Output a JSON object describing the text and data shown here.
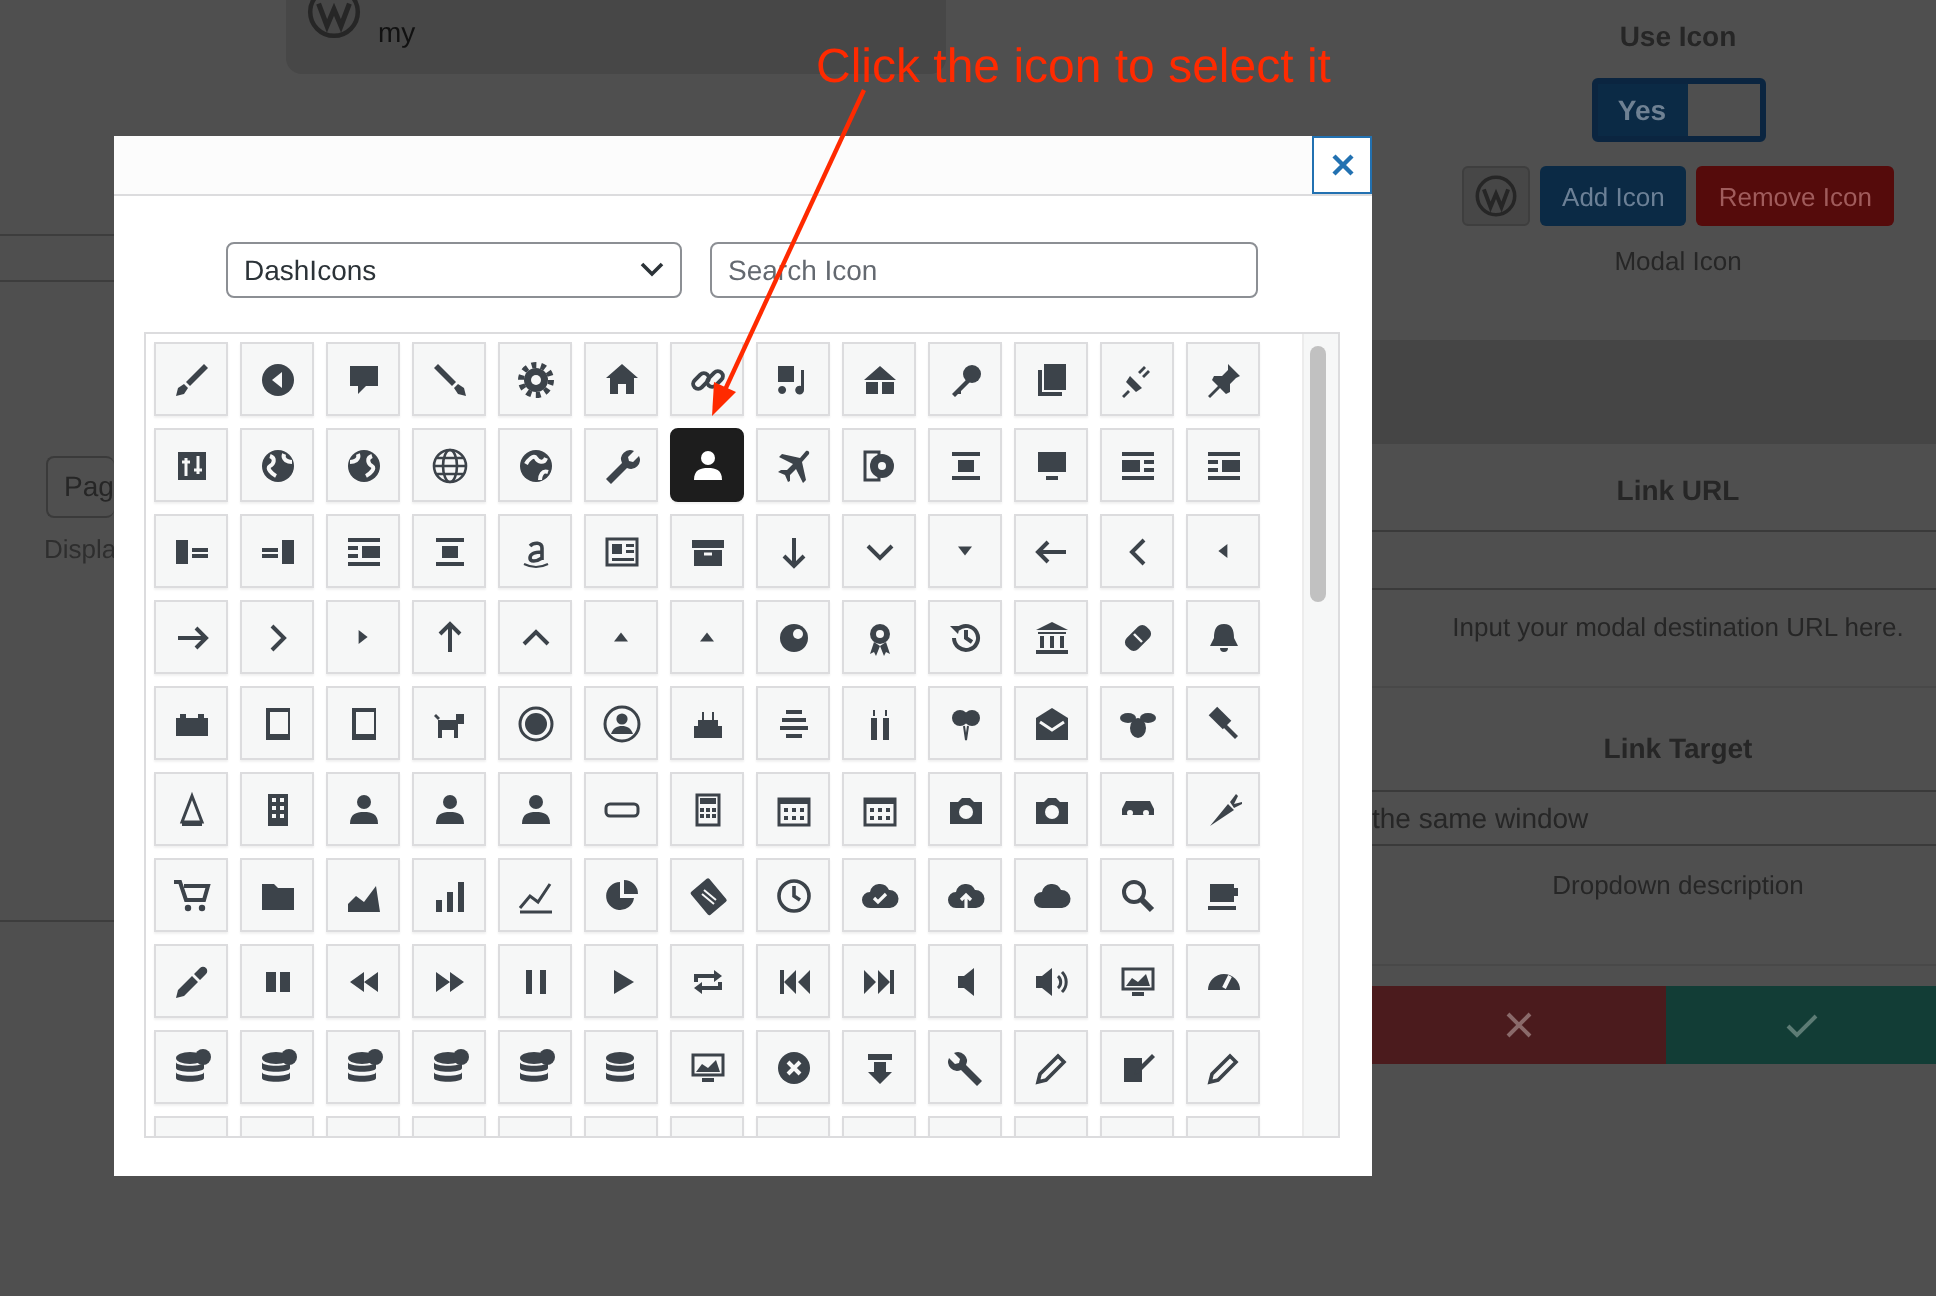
{
  "background": {
    "profile_card": {
      "subtitle": "my"
    },
    "page_select": {
      "value": "Pag"
    },
    "display_label": "Displa",
    "settings": {
      "use_icon_label": "Use Icon",
      "use_icon_toggle": {
        "label": "Yes",
        "on": true
      },
      "add_icon_button": "Add Icon",
      "remove_icon_button": "Remove Icon",
      "modal_icon_label": "Modal Icon",
      "link_url_label": "Link URL",
      "link_url_description": "Input your modal destination URL here.",
      "link_target_label": "Link Target",
      "link_target_value": "the same window",
      "dropdown_description": "Dropdown description"
    }
  },
  "modal": {
    "icon_set_select": {
      "value": "DashIcons"
    },
    "search": {
      "placeholder": "Search Icon"
    },
    "icon_rows": [
      {
        "tiles": [
          {
            "selected": false
          },
          {
            "selected": false
          },
          {
            "selected": false
          },
          {
            "selected": false
          },
          {
            "selected": false
          },
          {
            "selected": false
          },
          {
            "selected": false
          },
          {
            "selected": false
          },
          {
            "selected": false
          },
          {
            "selected": false
          },
          {
            "selected": false
          },
          {
            "selected": false
          },
          {
            "selected": false
          }
        ]
      },
      {
        "tiles": [
          {
            "selected": false
          },
          {
            "selected": false
          },
          {
            "selected": false
          },
          {
            "selected": false
          },
          {
            "selected": false
          },
          {
            "selected": false
          },
          {
            "selected": true
          },
          {
            "selected": false
          },
          {
            "selected": false
          },
          {
            "selected": false
          },
          {
            "selected": false
          },
          {
            "selected": false
          },
          {
            "selected": false
          }
        ]
      },
      {
        "tiles": [
          {
            "selected": false
          },
          {
            "selected": false
          },
          {
            "selected": false
          },
          {
            "selected": false
          },
          {
            "selected": false
          },
          {
            "selected": false
          },
          {
            "selected": false
          },
          {
            "selected": false
          },
          {
            "selected": false
          },
          {
            "selected": false
          },
          {
            "selected": false
          },
          {
            "selected": false
          },
          {
            "selected": false
          }
        ]
      },
      {
        "tiles": [
          {
            "selected": false
          },
          {
            "selected": false
          },
          {
            "selected": false
          },
          {
            "selected": false
          },
          {
            "selected": false
          },
          {
            "selected": false
          },
          {
            "selected": false
          },
          {
            "selected": false
          },
          {
            "selected": false
          },
          {
            "selected": false
          },
          {
            "selected": false
          },
          {
            "selected": false
          },
          {
            "selected": false
          }
        ]
      },
      {
        "tiles": [
          {
            "selected": false
          },
          {
            "selected": false
          },
          {
            "selected": false
          },
          {
            "selected": false
          },
          {
            "selected": false
          },
          {
            "selected": false
          },
          {
            "selected": false
          },
          {
            "selected": false
          },
          {
            "selected": false
          },
          {
            "selected": false
          },
          {
            "selected": false
          },
          {
            "selected": false
          },
          {
            "selected": false
          }
        ]
      },
      {
        "tiles": [
          {
            "selected": false
          },
          {
            "selected": false
          },
          {
            "selected": false
          },
          {
            "selected": false
          },
          {
            "selected": false
          },
          {
            "selected": false
          },
          {
            "selected": false
          },
          {
            "selected": false
          },
          {
            "selected": false
          },
          {
            "selected": false
          },
          {
            "selected": false
          },
          {
            "selected": false
          },
          {
            "selected": false
          }
        ]
      },
      {
        "tiles": [
          {
            "selected": false
          },
          {
            "selected": false
          },
          {
            "selected": false
          },
          {
            "selected": false
          },
          {
            "selected": false
          },
          {
            "selected": false
          },
          {
            "selected": false
          },
          {
            "selected": false
          },
          {
            "selected": false
          },
          {
            "selected": false
          },
          {
            "selected": false
          },
          {
            "selected": false
          },
          {
            "selected": false
          }
        ]
      },
      {
        "tiles": [
          {
            "selected": false
          },
          {
            "selected": false
          },
          {
            "selected": false
          },
          {
            "selected": false
          },
          {
            "selected": false
          },
          {
            "selected": false
          },
          {
            "selected": false
          },
          {
            "selected": false
          },
          {
            "selected": false
          },
          {
            "selected": false
          },
          {
            "selected": false
          },
          {
            "selected": false
          },
          {
            "selected": false
          }
        ]
      },
      {
        "tiles": [
          {
            "selected": false
          },
          {
            "selected": false
          },
          {
            "selected": false
          },
          {
            "selected": false
          },
          {
            "selected": false
          },
          {
            "selected": false
          },
          {
            "selected": false
          },
          {
            "selected": false
          },
          {
            "selected": false
          },
          {
            "selected": false
          },
          {
            "selected": false
          },
          {
            "selected": false
          },
          {
            "selected": false
          }
        ]
      },
      {
        "tiles": [
          {
            "selected": false
          },
          {
            "selected": false
          },
          {
            "selected": false
          },
          {
            "selected": false
          },
          {
            "selected": false
          },
          {
            "selected": false
          },
          {
            "selected": false
          },
          {
            "selected": false
          },
          {
            "selected": false
          },
          {
            "selected": false
          },
          {
            "selected": false
          },
          {
            "selected": false
          },
          {
            "selected": false
          }
        ]
      }
    ]
  },
  "annotation": {
    "text": "Click the icon to select it"
  }
}
